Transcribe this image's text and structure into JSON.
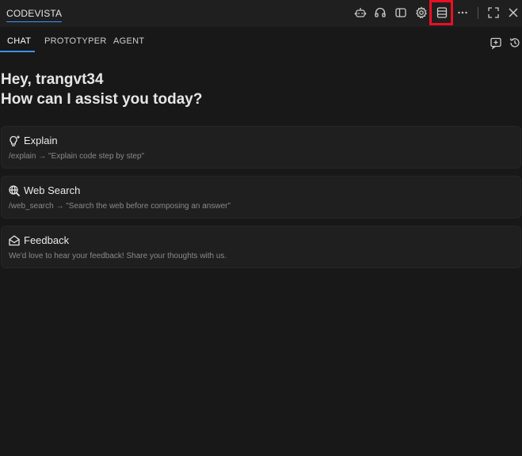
{
  "app": {
    "title": "CODEVISTA"
  },
  "titlebar_actions": [
    {
      "name": "bot-icon"
    },
    {
      "name": "headset-icon"
    },
    {
      "name": "panel-toggle-icon"
    },
    {
      "name": "gear-icon"
    },
    {
      "name": "layout-rows-icon"
    },
    {
      "name": "more-icon"
    },
    {
      "name": "fullscreen-icon"
    },
    {
      "name": "close-icon"
    }
  ],
  "tabs": [
    {
      "label": "CHAT",
      "active": true
    },
    {
      "label": "PROTOTYPER",
      "active": false
    },
    {
      "label": "AGENT",
      "active": false
    }
  ],
  "greeting": {
    "line1": "Hey, trangvt34",
    "line2": "How can I assist you today?"
  },
  "cards": [
    {
      "icon": "lightbulb-icon",
      "title": "Explain",
      "desc": "/explain → \"Explain code step by step\""
    },
    {
      "icon": "web-search-icon",
      "title": "Web Search",
      "desc": "/web_search → \"Search the web before composing an answer\""
    },
    {
      "icon": "mail-open-icon",
      "title": "Feedback",
      "desc": "We'd love to hear your feedback! Share your thoughts with us."
    }
  ],
  "colors": {
    "background": "#181818",
    "accent": "#3794ff",
    "highlight": "#e81123"
  }
}
